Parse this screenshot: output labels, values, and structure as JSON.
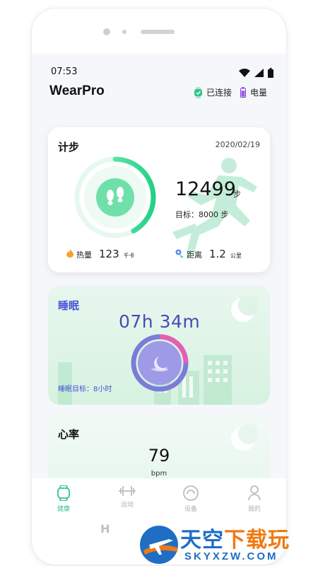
{
  "status": {
    "time": "07:53"
  },
  "header": {
    "app_title": "WearPro",
    "connected_label": "已连接",
    "battery_label": "电量"
  },
  "steps_card": {
    "title": "计步",
    "date": "2020/02/19",
    "steps": "12499",
    "steps_unit": "步",
    "goal_label": "目标：8000 步",
    "goal_progress": 0.42,
    "calories_label": "热量",
    "calories_value": "123",
    "calories_unit": "千卡",
    "distance_label": "距离",
    "distance_value": "1.2",
    "distance_unit": "公里"
  },
  "sleep_card": {
    "title": "睡眠",
    "duration": "07h 34m",
    "goal_label": "睡眠目标：8小时"
  },
  "heart_card": {
    "title": "心率",
    "value": "79",
    "unit": "bpm"
  },
  "tabbar": {
    "items": [
      {
        "label": "健康",
        "icon": "watch-icon",
        "active": true
      },
      {
        "label": "运动",
        "icon": "dumbbell-icon",
        "active": false
      },
      {
        "label": "设备",
        "icon": "device-icon",
        "active": false
      },
      {
        "label": "我的",
        "icon": "person-icon",
        "active": false
      }
    ]
  },
  "watermark": {
    "top_blue": "天空",
    "top_orange": "下载玩",
    "bottom": "SKYXZW.COM"
  },
  "colors": {
    "accent": "#2fc58a",
    "sleep": "#4a55d6",
    "watermark_blue": "#1f6ec4",
    "watermark_orange": "#f07a12"
  }
}
